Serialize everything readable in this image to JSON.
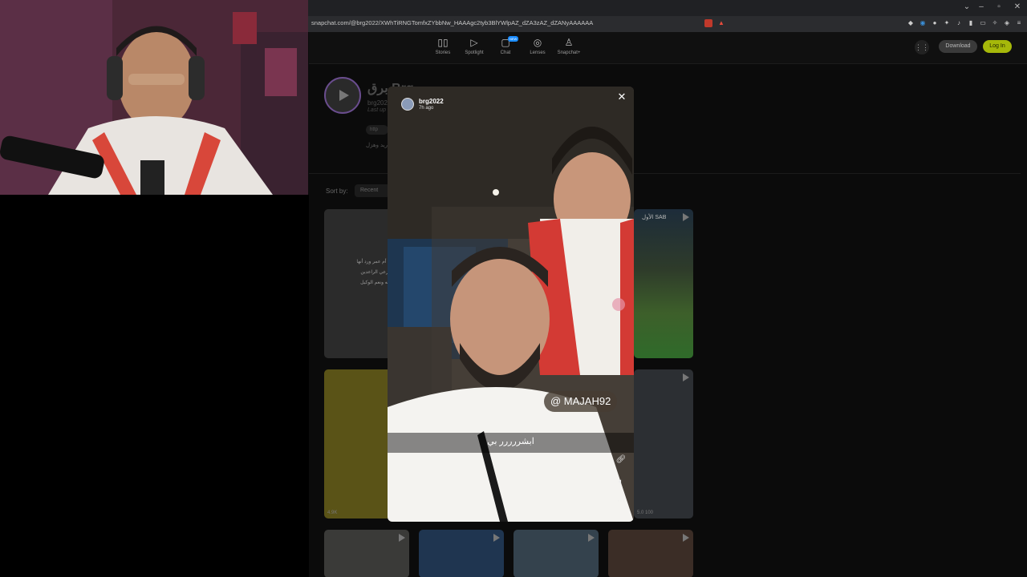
{
  "browser": {
    "url": "snapchat.com/@brg2022/XWhTiRNGTomfxZYbbNw_HAAAgc2tyb3BlYWlpAZ_dZA3zAZ_dZANyAAAAAA",
    "window_controls": [
      "⌄",
      "–",
      "▫",
      "✕"
    ],
    "extension_icons": [
      "shield-icon",
      "alert-icon"
    ]
  },
  "snap_header": {
    "nav": [
      {
        "label": "Stories",
        "icon": "stories-icon"
      },
      {
        "label": "Spotlight",
        "icon": "play-icon"
      },
      {
        "label": "Chat",
        "icon": "chat-icon",
        "badge": "NEW"
      },
      {
        "label": "Lenses",
        "icon": "lens-icon"
      },
      {
        "label": "Snapchat+",
        "icon": "ghost-icon"
      }
    ],
    "download_label": "Download",
    "login_label": "Log In"
  },
  "profile": {
    "name": "برق Brg",
    "handle": "brg202",
    "last_updated": "Last up",
    "link_label": "http",
    "bio": "ريد وهزل"
  },
  "sort": {
    "label": "Sort by:",
    "value": "Recent"
  },
  "tiles": {
    "tile1_text": [
      "أن الشعر أم عمر ورد أنها",
      "قلتها يا الرعي الراعدين",
      "حسبي الله ونعم الوكيل"
    ],
    "tile2_brand": "الأول SAB",
    "tile3_stats": "4.9K",
    "tile4_stats": "5.0 100"
  },
  "story": {
    "username": "brg2022",
    "time_ago": "7h ago",
    "mention": "@ MAJAH92",
    "caption": "ابشررررر بي"
  },
  "colors": {
    "login_accent": "#a6b80a",
    "avatar_ring": "#6a4d8e"
  }
}
